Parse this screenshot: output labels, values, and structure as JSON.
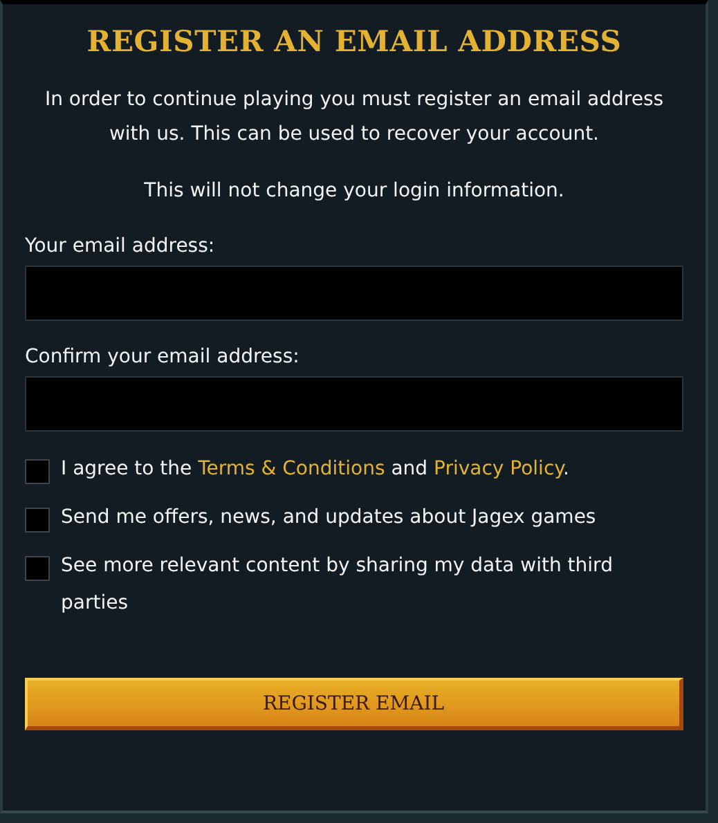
{
  "title": "REGISTER AN EMAIL ADDRESS",
  "intro": "In order to continue playing you must register an email address with us. This can be used to recover your account.",
  "note": "This will not change your login information.",
  "fields": [
    {
      "label": "Your email address:"
    },
    {
      "label": "Confirm your email address:"
    }
  ],
  "checkboxes": [
    {
      "checked": false,
      "parts": [
        {
          "kind": "text",
          "text": "I agree to the "
        },
        {
          "kind": "link",
          "text": "Terms & Conditions"
        },
        {
          "kind": "text",
          "text": " and "
        },
        {
          "kind": "link",
          "text": "Privacy Policy"
        },
        {
          "kind": "text",
          "text": "."
        }
      ]
    },
    {
      "checked": false,
      "parts": [
        {
          "kind": "text",
          "text": "Send me offers, news, and updates about Jagex games"
        }
      ]
    },
    {
      "checked": false,
      "parts": [
        {
          "kind": "text",
          "text": "See more relevant content by sharing my data with third parties"
        }
      ]
    }
  ],
  "button": "REGISTER EMAIL"
}
